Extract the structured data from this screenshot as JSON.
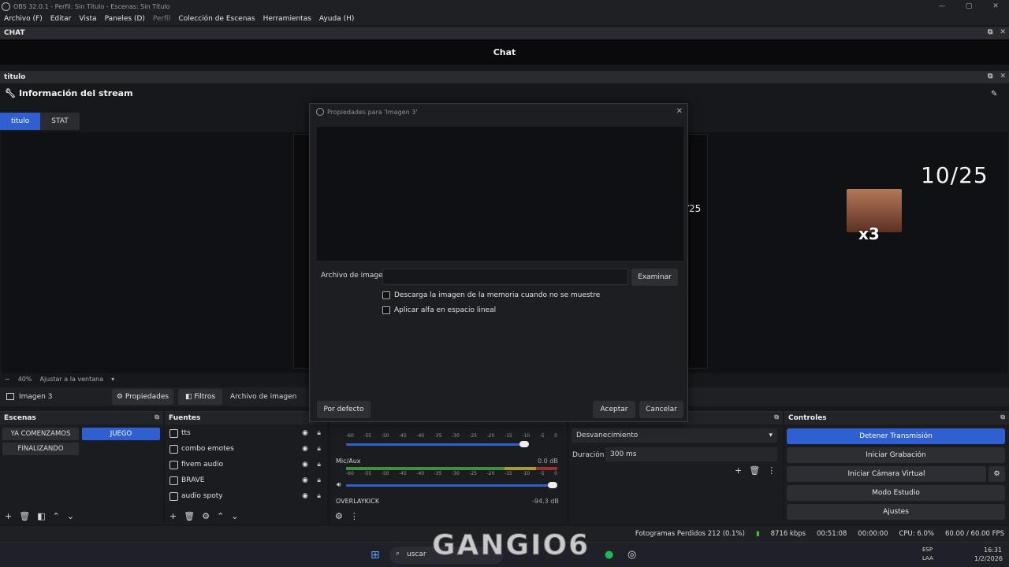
{
  "window": {
    "title": "OBS 32.0.1 - Perfil: Sin Título - Escenas: Sin Título"
  },
  "menu": [
    "Archivo (F)",
    "Editar",
    "Vista",
    "Paneles (D)",
    "Perfil",
    "Colección de Escenas",
    "Herramientas",
    "Ayuda (H)"
  ],
  "chat": {
    "dock_title": "CHAT",
    "header": "Chat"
  },
  "titulo": {
    "dock_title": "titulo",
    "stream_info": "Información del stream",
    "tabs": [
      "titulo",
      "STAT"
    ]
  },
  "preview": {
    "counter": "10/25",
    "counter_small": "/25",
    "emote_label": "x3",
    "zoom": "40%",
    "fit": "Ajustar a la ventana"
  },
  "source_bar": {
    "name": "Imagen 3",
    "properties": "Propiedades",
    "filters": "Filtros",
    "type": "Archivo de imagen"
  },
  "scenes": {
    "title": "Escenas",
    "items": [
      "YA COMENZAMOS",
      "JUEGO",
      "FINALIZANDO"
    ],
    "selected": "JUEGO"
  },
  "sources": {
    "title": "Fuentes",
    "items": [
      "tts",
      "combo emotes",
      "fivem audio",
      "BRAVE",
      "audio spoty"
    ]
  },
  "mixer": {
    "scale": [
      "-60",
      "-55",
      "-50",
      "-45",
      "-40",
      "-35",
      "-30",
      "-25",
      "-20",
      "-15",
      "-10",
      "-5",
      "0"
    ],
    "channels": [
      {
        "name": "Mic/Aux",
        "db": "0.0 dB"
      },
      {
        "name": "OVERLAYKICK",
        "db": "-94.3 dB"
      }
    ]
  },
  "transitions": {
    "type": "Desvanecimiento",
    "duration_label": "Duración",
    "duration": "300 ms"
  },
  "controls": {
    "title": "Controles",
    "buttons": [
      "Detener Transmisión",
      "Iniciar Grabación",
      "Iniciar Cámara Virtual",
      "Modo Estudio",
      "Ajustes"
    ]
  },
  "status": {
    "dropped": "Fotogramas Perdidos 212 (0.1%)",
    "bitrate": "8716 kbps",
    "time": "00:51:08",
    "rec_time": "00:00:00",
    "cpu": "CPU: 6.0%",
    "fps": "60.00 / 60.00 FPS"
  },
  "taskbar": {
    "search": "uscar",
    "lang": "ESP",
    "lang2": "LAA",
    "clock": "16:31",
    "date": "1/2/2026",
    "overlay_text": "GANGIO6"
  },
  "dialog": {
    "title": "Propiedades para 'Imagen 3'",
    "image_file_label": "Archivo de imagen",
    "image_file_value": "",
    "browse": "Examinar",
    "check1": "Descarga la imagen de la memoria cuando no se muestre",
    "check2": "Aplicar alfa en espacio lineal",
    "defaults": "Por defecto",
    "accept": "Aceptar",
    "cancel": "Cancelar"
  }
}
